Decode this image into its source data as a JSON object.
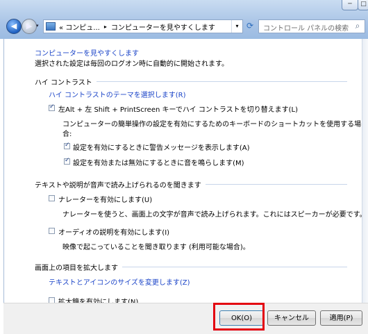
{
  "window": {
    "title_controls": {
      "minimize": "─",
      "maximize": "□"
    }
  },
  "toolbar": {
    "back_glyph": "◀",
    "forward_glyph": "▶",
    "breadcrumb": [
      "« コンピュ...",
      "コンピューターを見やすくします"
    ],
    "breadcrumb_sep": "▸",
    "dropdown_glyph": "▾",
    "refresh_glyph": "⟳",
    "search_placeholder": "コントロール パネルの検索",
    "search_icon_glyph": "⌕"
  },
  "page": {
    "title": "コンピューターを見やすくします",
    "subtitle": "選択された設定は毎回のログオン時に自動的に開始されます。",
    "sections": {
      "high_contrast": {
        "heading": "ハイ コントラスト",
        "theme_link": "ハイ コントラストのテーマを選択します(R)",
        "shortcut_toggle": {
          "label": "左Alt + 左 Shift + PrintScreen キーでハイ コントラストを切り替えます(L)",
          "checked": true
        },
        "shortcut_desc_1": "コンピューターの簡単操作の設定を有効にするためのキーボードのショートカットを使用する場",
        "shortcut_desc_2": "合:",
        "warn_toggle": {
          "label": "設定を有効にするときに警告メッセージを表示します(A)",
          "checked": true
        },
        "sound_toggle": {
          "label": "設定を有効または無効にするときに音を鳴らします(M)",
          "checked": true
        }
      },
      "narration": {
        "heading": "テキストや説明が音声で読み上げられるのを聞きます",
        "narrator_toggle": {
          "label": "ナレーターを有効にします(U)",
          "checked": false
        },
        "narrator_desc": "ナレーターを使うと、画面上の文字が音声で読み上げられます。これにはスピーカーが必要です。",
        "audio_desc_toggle": {
          "label": "オーディオの説明を有効にします(I)",
          "checked": false
        },
        "audio_desc_desc": "映像で起こっていることを聞き取ります (利用可能な場合)。"
      },
      "magnify": {
        "heading": "画面上の項目を拡大します",
        "size_link": "テキストとアイコンのサイズを変更します(Z)",
        "magnifier_toggle": {
          "label": "拡大鏡を有効にします(N)",
          "checked": false
        }
      }
    }
  },
  "footer": {
    "ok": "OK(O)",
    "cancel": "キャンセル",
    "apply": "適用(P)"
  },
  "colors": {
    "link": "#1c45c8",
    "highlight": "#e30010"
  }
}
